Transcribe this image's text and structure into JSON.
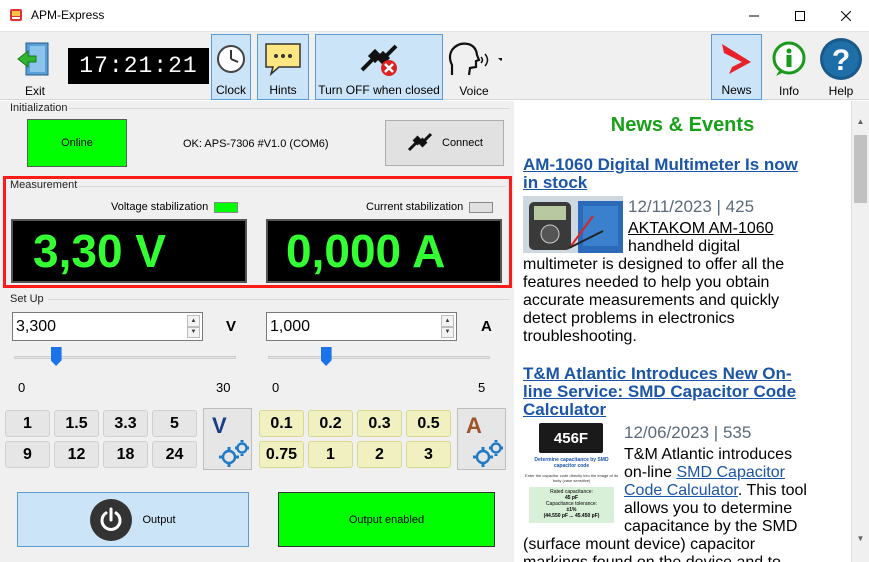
{
  "window": {
    "title": "APM-Express"
  },
  "toolbar": {
    "exit_label": "Exit",
    "clock_time": "17:21:21",
    "clock_label": "Clock",
    "hints_label": "Hints",
    "turn_off_label": "Turn OFF when closed",
    "voice_label": "Voice",
    "news_label": "News",
    "info_label": "Info",
    "help_label": "Help"
  },
  "initialization": {
    "group_label": "Initialization",
    "online_label": "Online",
    "status_text": "OK: APS-7306 #V1.0 (COM6)",
    "connect_label": "Connect"
  },
  "measurement": {
    "group_label": "Measurement",
    "voltage_stab_label": "Voltage stabilization",
    "current_stab_label": "Current stabilization",
    "voltage_reading": "3,30 V",
    "current_reading": "0,000 A",
    "voltage_led_color": "#00ff00",
    "current_led_color": "#e0e0e0"
  },
  "setup": {
    "group_label": "Set Up",
    "voltage_value": "3,300",
    "voltage_unit": "V",
    "current_value": "1,000",
    "current_unit": "A",
    "voltage_slider": {
      "min_label": "0",
      "max_label": "30",
      "min": 0,
      "max": 30,
      "value": 3.3
    },
    "current_slider": {
      "min_label": "0",
      "max_label": "5",
      "min": 0,
      "max": 5,
      "value": 1.0
    },
    "voltage_presets": [
      "1",
      "1.5",
      "3.3",
      "5",
      "9",
      "12",
      "18",
      "24"
    ],
    "current_presets": [
      "0.1",
      "0.2",
      "0.3",
      "0.5",
      "0.75",
      "1",
      "2",
      "3"
    ],
    "voltage_mode_letter": "V",
    "current_mode_letter": "A"
  },
  "output": {
    "button_label": "Output",
    "status_label": "Output enabled"
  },
  "news": {
    "heading": "News & Events",
    "articles": [
      {
        "title_line1": "AM-1060 Digital Multimeter Is now",
        "title_line2": "in stock",
        "meta": "12/11/2023 | 425",
        "link_text": "AKTAKOM AM-1060",
        "body_line1": "handheld digital",
        "body_rest": [
          "multimeter is designed to offer all the",
          "features needed to help you obtain",
          "accurate measurements and quickly",
          "detect problems in electronics",
          "troubleshooting."
        ]
      },
      {
        "title_line1": "T&M Atlantic Introduces New On-",
        "title_line2": "line Service: SMD Capacitor Code",
        "title_line3": "Calculator",
        "meta": "12/06/2023 | 535",
        "thumb_code": "456F",
        "thumb_caption": "Determine capacitance by SMD capacitor code",
        "thumb_hint": "Enter the capacitor code directly into the image of its body (case sensitive)",
        "thumb_result1": "Rated capacitance:",
        "thumb_result2": "45 pF",
        "thumb_result3": "Capacitance tolerance:",
        "thumb_result4": "±1%",
        "thumb_result5": "(44.550 pF ... 45.450 pF)",
        "body_line1": "T&M Atlantic introduces",
        "body_line2": "on-line",
        "link_text_1": "SMD Capacitor",
        "link_text_2": "Code Calculator",
        "body_line3_suffix": ". This tool",
        "body_rest": [
          "allows you to determine",
          "capacitance by the SMD",
          "(surface mount device) capacitor",
          "markings found on the device and to"
        ]
      }
    ]
  }
}
